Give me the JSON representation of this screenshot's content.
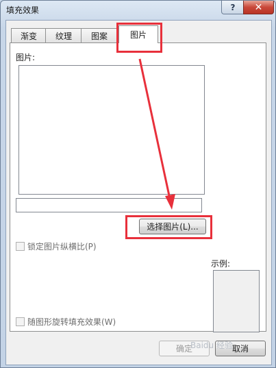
{
  "window": {
    "title": "填充效果",
    "help_label": "?",
    "close_label": "✕"
  },
  "tabs": [
    {
      "label": "渐变"
    },
    {
      "label": "纹理"
    },
    {
      "label": "图案"
    },
    {
      "label": "图片"
    }
  ],
  "panel": {
    "picture_label": "图片:",
    "name_value": "",
    "select_button_label": "选择图片(L)...",
    "lock_ratio_label": "锁定图片纵横比(P)",
    "lock_ratio_checked": false,
    "rotate_label": "随图形旋转填充效果(W)",
    "rotate_checked": false,
    "sample_label": "示例:"
  },
  "footer": {
    "ok_label": "确定",
    "cancel_label": "取消"
  },
  "annotation": {
    "color": "#e8303b",
    "watermark": "Baidu 经验"
  }
}
